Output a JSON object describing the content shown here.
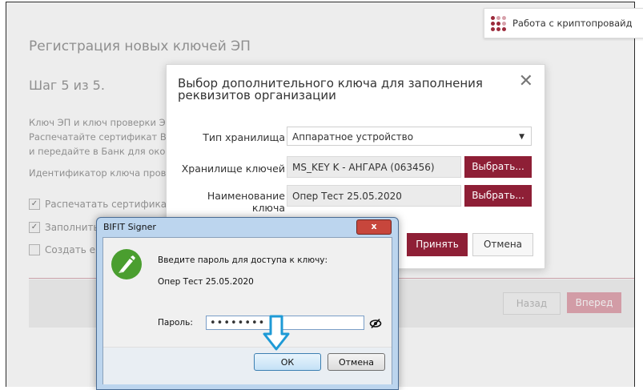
{
  "background": {
    "title": "Регистрация новых ключей ЭП",
    "step": "Шаг 5 из 5.",
    "lines": [
      "Ключ ЭП и ключ проверки Э",
      "Распечатайте сертификат Ва",
      "и передайте в Банк для окон",
      "Идентификатор ключа пров"
    ],
    "checkboxes": [
      {
        "label": "Распечатать сертификат",
        "checked": true
      },
      {
        "label": "Заполнить",
        "checked": true
      },
      {
        "label": "Создать ец",
        "checked": false
      }
    ],
    "back_label": "Назад",
    "next_label": "Вперед",
    "crypto_label": "Работа с криптопровайд"
  },
  "modal": {
    "title": "Выбор дополнительного ключа для заполнения реквизитов организации",
    "storage_type_label": "Тип хранилища",
    "storage_type_value": "Аппаратное устройство",
    "key_storage_label": "Хранилище ключей",
    "key_storage_value": "MS_KEY K - АНГАРА (063456)",
    "key_name_label": "Наименование ключа",
    "key_name_value": "Опер Тест 25.05.2020",
    "choose_label": "Выбрать...",
    "accept_label": "Принять",
    "cancel_label": "Отмена"
  },
  "signer": {
    "title": "BIFIT Signer",
    "close_glyph": "x",
    "prompt": "Введите пароль для доступа к ключу:",
    "key_name": "Опер Тест 25.05.2020",
    "password_label": "Пароль:",
    "password_value": "••••••••",
    "ok_label": "ОК",
    "cancel_label": "Отмена"
  },
  "colors": {
    "accent": "#8e1f36",
    "arrow": "#1e9ad6"
  }
}
